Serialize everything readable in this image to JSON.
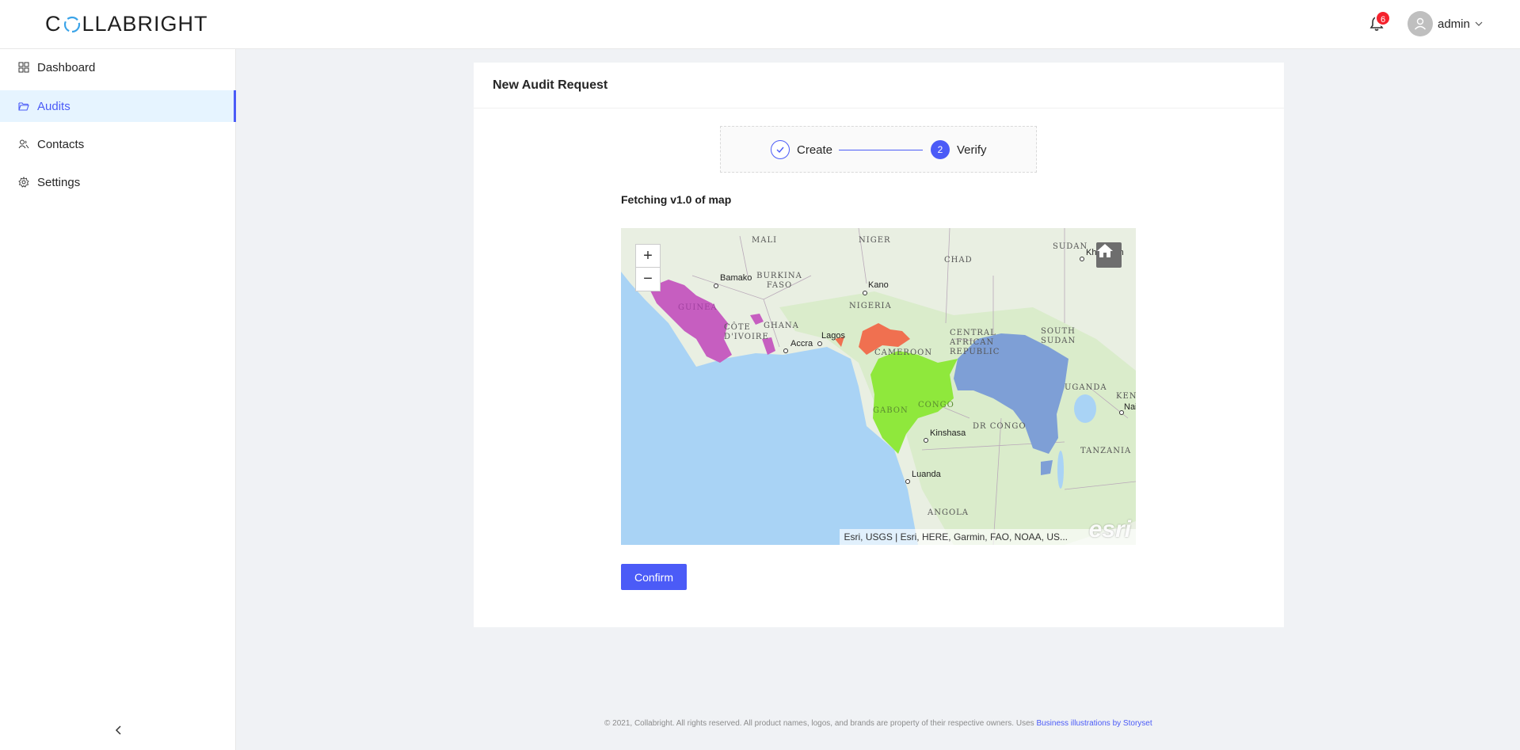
{
  "app": {
    "logo_text_pre": "C",
    "logo_text_post": "LLABRIGHT",
    "notification_count": "6",
    "user_name": "admin"
  },
  "sidebar": {
    "items": [
      {
        "label": "Dashboard",
        "icon": "grid-icon"
      },
      {
        "label": "Audits",
        "icon": "folder-open-icon",
        "active": true
      },
      {
        "label": "Contacts",
        "icon": "contacts-icon"
      },
      {
        "label": "Settings",
        "icon": "gear-icon"
      }
    ]
  },
  "card": {
    "title": "New Audit Request",
    "steps": [
      {
        "label": "Create",
        "status": "finished"
      },
      {
        "label": "Verify",
        "number": "2",
        "status": "current"
      }
    ],
    "fetch_label": "Fetching v1.0 of map",
    "confirm_label": "Confirm"
  },
  "map": {
    "zoom_in": "+",
    "zoom_out": "−",
    "attribution": "Esri, USGS | Esri, HERE, Garmin, FAO, NOAA, US...",
    "esri_logo": "esri",
    "labels": {
      "mali": "MALI",
      "niger": "NIGER",
      "chad": "CHAD",
      "sudan": "SUDAN",
      "khartoum": "Khartoum",
      "bamako": "Bamako",
      "burkina_faso": "BURKINA FASO",
      "kano": "Kano",
      "nigeria": "NIGERIA",
      "guinea": "GUINEA",
      "cote_divoire": "CÔTE D'IVOIRE",
      "ghana": "GHANA",
      "accra": "Accra",
      "lagos": "Lagos",
      "cameroon": "CAMEROON",
      "car": "CENTRAL AFRICAN REPUBLIC",
      "south_sudan": "SOUTH SUDAN",
      "gabon": "GABON",
      "congo": "CONGO",
      "kinshasa": "Kinshasa",
      "dr_congo": "DR CONGO",
      "uganda": "UGANDA",
      "kenya": "KENYA",
      "nairobi": "Nairobi",
      "tanzania": "TANZANIA",
      "luanda": "Luanda",
      "angola": "ANGOLA"
    },
    "colors": {
      "ocean": "#a9d3f5",
      "land": "#e9efe2",
      "purple_region": "#c65ec0",
      "red_region": "#f07050",
      "green_region": "#8fe83c",
      "blue_region": "#7e9fd6"
    }
  },
  "footer": {
    "text": "© 2021, Collabright. All rights reserved. All product names, logos, and brands are property of their respective owners. Uses",
    "link": "Business illustrations by Storyset"
  }
}
